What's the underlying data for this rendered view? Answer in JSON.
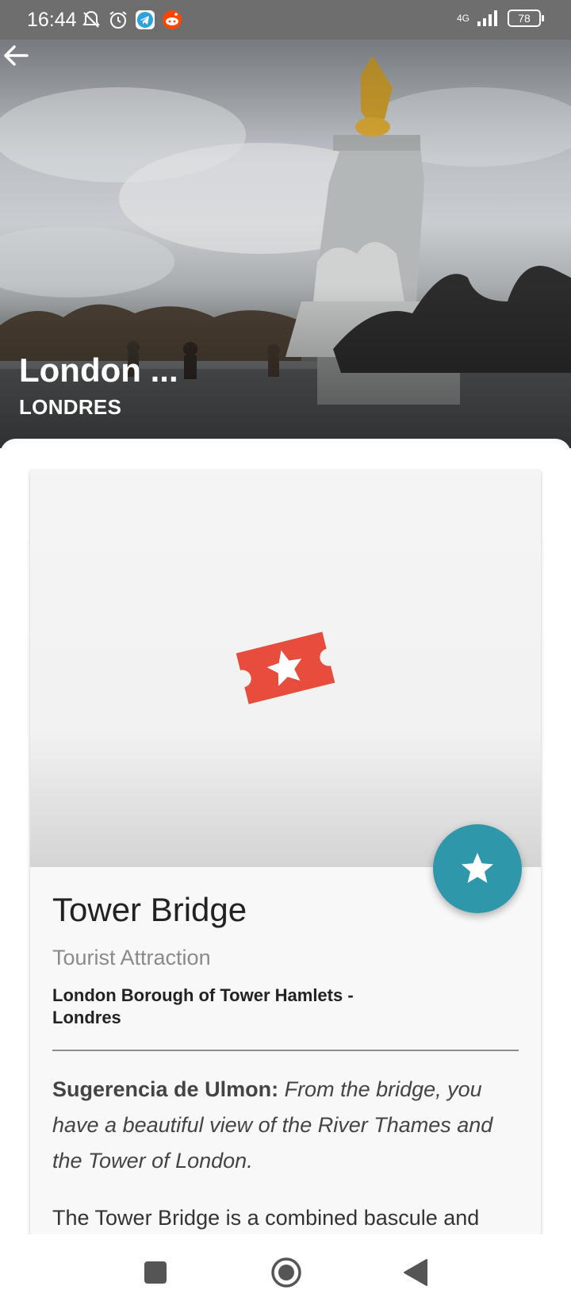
{
  "status_bar": {
    "time": "16:44",
    "network": "4G",
    "battery": "78",
    "icons": [
      "bell-off-icon",
      "alarm-icon",
      "telegram-icon",
      "reddit-icon",
      "signal-icon",
      "battery-icon"
    ]
  },
  "header": {
    "title": "London ...",
    "subtitle": "LONDRES",
    "back_icon": "arrow-left-icon"
  },
  "place": {
    "name": "Tower Bridge",
    "category": "Tourist Attraction",
    "address": "London Borough of Tower Hamlets - Londres",
    "placeholder_icon": "ticket-star-icon",
    "favorite_icon": "star-icon"
  },
  "tip": {
    "label": "Sugerencia de Ulmon:",
    "text": "From the bridge, you have a beautiful view of the River Thames and the Tower of London."
  },
  "description": {
    "text": "The Tower Bridge is a combined bascule and"
  },
  "colors": {
    "accent": "#2e97aa",
    "ticket": "#e74c3c",
    "status_bar": "#6e6e6e"
  },
  "nav_bar": {
    "icons": [
      "recents-square-icon",
      "home-circle-icon",
      "back-triangle-icon"
    ]
  }
}
